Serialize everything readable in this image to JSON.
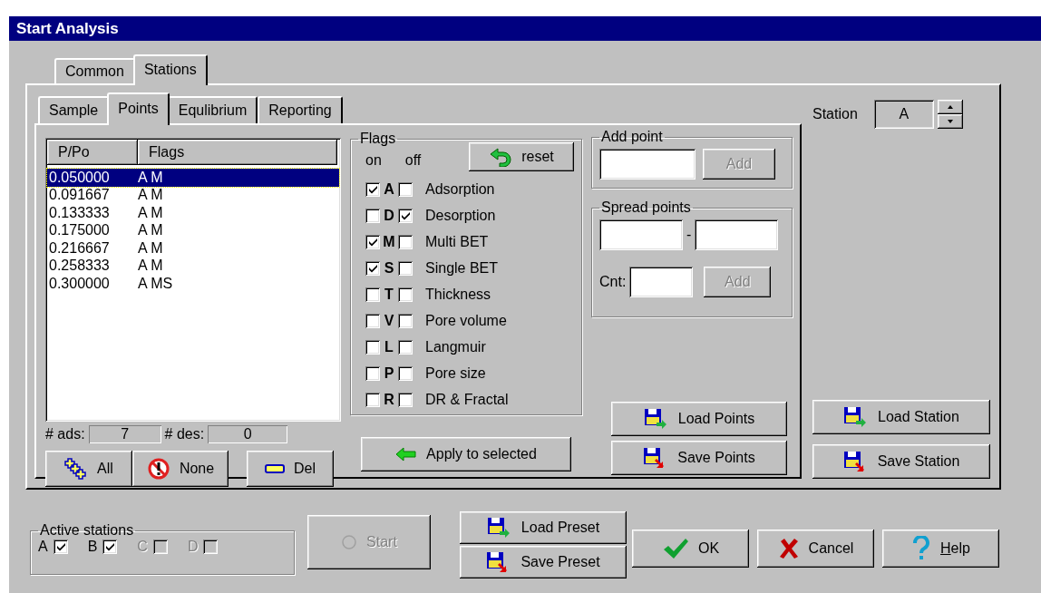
{
  "window": {
    "title": "Start Analysis"
  },
  "tabs": [
    {
      "label": "Common",
      "selected": false
    },
    {
      "label": "Stations",
      "selected": true
    }
  ],
  "subtabs": [
    {
      "label": "Sample",
      "selected": false
    },
    {
      "label": "Points",
      "selected": true
    },
    {
      "label": "Equlibrium",
      "selected": false
    },
    {
      "label": "Reporting",
      "selected": false
    }
  ],
  "points_list": {
    "columns": [
      "P/Po",
      "Flags"
    ],
    "rows": [
      {
        "p": "0.050000",
        "flags": "A M",
        "selected": true
      },
      {
        "p": "0.091667",
        "flags": "A M",
        "selected": false
      },
      {
        "p": "0.133333",
        "flags": "A M",
        "selected": false
      },
      {
        "p": "0.175000",
        "flags": "A M",
        "selected": false
      },
      {
        "p": "0.216667",
        "flags": "A M",
        "selected": false
      },
      {
        "p": "0.258333",
        "flags": "A M",
        "selected": false
      },
      {
        "p": "0.300000",
        "flags": "A MS",
        "selected": false
      }
    ]
  },
  "counts": {
    "ads_label": "# ads:",
    "ads": "7",
    "des_label": "# des:",
    "des": "0"
  },
  "list_buttons": [
    {
      "label": "All",
      "kind": "all"
    },
    {
      "label": "None",
      "kind": "none"
    },
    {
      "label": "Del",
      "kind": "del"
    }
  ],
  "flags": {
    "title": "Flags",
    "on_label": "on",
    "off_label": "off",
    "reset": "reset",
    "items": [
      {
        "letter": "A",
        "name": "Adsorption",
        "on": true,
        "off": false
      },
      {
        "letter": "D",
        "name": "Desorption",
        "on": false,
        "off": true
      },
      {
        "letter": "M",
        "name": "Multi BET",
        "on": true,
        "off": false
      },
      {
        "letter": "S",
        "name": "Single BET",
        "on": true,
        "off": false
      },
      {
        "letter": "T",
        "name": "Thickness",
        "on": false,
        "off": false
      },
      {
        "letter": "V",
        "name": "Pore volume",
        "on": false,
        "off": false
      },
      {
        "letter": "L",
        "name": "Langmuir",
        "on": false,
        "off": false
      },
      {
        "letter": "P",
        "name": "Pore size",
        "on": false,
        "off": false
      },
      {
        "letter": "R",
        "name": "DR & Fractal",
        "on": false,
        "off": false
      }
    ]
  },
  "apply": "Apply to selected",
  "add_point": {
    "title": "Add point",
    "button": "Add",
    "disabled": true
  },
  "spread_points": {
    "title": "Spread points",
    "separator": "-",
    "count_label": "Cnt:",
    "button": "Add",
    "disabled": true
  },
  "points_buttons": [
    {
      "label": "Load Points",
      "kind": "load"
    },
    {
      "label": "Save Points",
      "kind": "save"
    }
  ],
  "station": {
    "label": "Station",
    "value": "A"
  },
  "station_buttons": [
    {
      "label": "Load Station",
      "kind": "load"
    },
    {
      "label": "Save Station",
      "kind": "save"
    }
  ],
  "active_stations": {
    "title": "Active stations",
    "items": [
      {
        "label": "A",
        "checked": true,
        "disabled": false
      },
      {
        "label": "B",
        "checked": true,
        "disabled": false
      },
      {
        "label": "C",
        "checked": false,
        "disabled": true
      },
      {
        "label": "D",
        "checked": false,
        "disabled": true
      }
    ]
  },
  "start": {
    "label": "Start",
    "disabled": true
  },
  "preset_buttons": [
    {
      "label": "Load Preset",
      "kind": "load"
    },
    {
      "label": "Save Preset",
      "kind": "save"
    }
  ],
  "dialog_buttons": [
    {
      "label": "OK",
      "kind": "ok"
    },
    {
      "label": "Cancel",
      "kind": "cancel"
    },
    {
      "label": "Help",
      "kind": "help"
    }
  ]
}
